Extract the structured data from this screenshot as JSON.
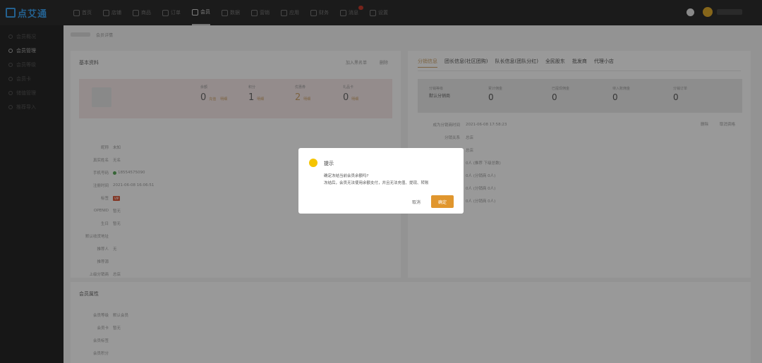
{
  "app": {
    "logo": "点艾通"
  },
  "nav": [
    {
      "label": "首页",
      "icon": "home-icon"
    },
    {
      "label": "店铺",
      "icon": "shop-icon"
    },
    {
      "label": "商品",
      "icon": "goods-icon"
    },
    {
      "label": "订单",
      "icon": "order-icon"
    },
    {
      "label": "会员",
      "icon": "member-icon"
    },
    {
      "label": "数据",
      "icon": "data-icon"
    },
    {
      "label": "营销",
      "icon": "marketing-icon"
    },
    {
      "label": "应用",
      "icon": "apps-icon"
    },
    {
      "label": "财务",
      "icon": "finance-icon"
    },
    {
      "label": "消息",
      "icon": "message-icon"
    },
    {
      "label": "设置",
      "icon": "settings-icon"
    }
  ],
  "sidebar": [
    {
      "label": "会员概况"
    },
    {
      "label": "会员管理"
    },
    {
      "label": "会员等级"
    },
    {
      "label": "会员卡"
    },
    {
      "label": "储值管理"
    },
    {
      "label": "推荐导入"
    }
  ],
  "breadcrumb": {
    "current": "会员详情"
  },
  "basic": {
    "title": "基本资料",
    "action_1": "加入黑名单",
    "action_2": "删除",
    "stats": [
      {
        "label": "余额",
        "value": "0",
        "link1": "充值",
        "link2": "明细"
      },
      {
        "label": "积分",
        "value": "1",
        "link1": "明细",
        "link2": ""
      },
      {
        "label": "优惠券",
        "value": "2",
        "link1": "明细",
        "link2": ""
      },
      {
        "label": "礼品卡",
        "value": "0",
        "link1": "明细",
        "link2": ""
      }
    ],
    "fields": [
      {
        "label": "昵称",
        "value": "未知"
      },
      {
        "label": "真实姓名",
        "value": "无名"
      },
      {
        "label": "手机号码",
        "value": "18554575090"
      },
      {
        "label": "注册时间",
        "value": "2021-06-08 16:06:51"
      },
      {
        "label": "标签",
        "value": "VIP"
      },
      {
        "label": "OPENID",
        "value": "暂无"
      },
      {
        "label": "生日",
        "value": "暂无"
      },
      {
        "label": "默认收货地址",
        "value": ""
      },
      {
        "label": "推荐人",
        "value": "无"
      },
      {
        "label": "推荐源",
        "value": ""
      },
      {
        "label": "上级分销商",
        "value": "总店"
      },
      {
        "label": "备注",
        "value": "未填写"
      }
    ]
  },
  "right": {
    "tabs": [
      "分销信息",
      "团长信息(社区团购)",
      "队长信息(团队分红)",
      "全民股东",
      "批发商",
      "代理小店"
    ],
    "stats": [
      {
        "label": "分销等级",
        "value": "默认分销商"
      },
      {
        "label": "累计佣金",
        "value": "0",
        "sub": "明细"
      },
      {
        "label": "已提现佣金",
        "value": "0",
        "sub": ""
      },
      {
        "label": "待入账佣金",
        "value": "0",
        "sub": ""
      },
      {
        "label": "分销订单",
        "value": "0",
        "sub": ""
      }
    ],
    "time_label": "成为分销商时间",
    "time_value": "2021-06-08 17:58:23",
    "action_1": "删除",
    "action_2": "取消资格",
    "fields": [
      {
        "label": "分销关系",
        "value": "总店"
      },
      {
        "label": "",
        "value": "总店"
      },
      {
        "label": "",
        "value": "0人 (推荐 下级总数)"
      },
      {
        "label": "",
        "value": "0人 (分销商 0人)"
      },
      {
        "label": "",
        "value": "0人 (分销商 0人)"
      },
      {
        "label": "",
        "value": "0人 (分销商 0人)"
      }
    ]
  },
  "member_attr": {
    "title": "会员属性",
    "fields": [
      {
        "label": "会员等级",
        "value": "默认会员"
      },
      {
        "label": "会员卡",
        "value": "暂无"
      },
      {
        "label": "会员标签",
        "value": ""
      },
      {
        "label": "会员积分",
        "value": ""
      }
    ]
  },
  "dialog": {
    "title": "提示",
    "line1": "确定冻结当前会员余额吗?",
    "line2": "冻结后，会员无法使用余额支付，并且无法充值、提现、转账",
    "cancel": "取消",
    "confirm": "确定"
  },
  "colors": {
    "accent": "#e0962e",
    "warning": "#f5c400",
    "vip": "#d45a3d"
  }
}
